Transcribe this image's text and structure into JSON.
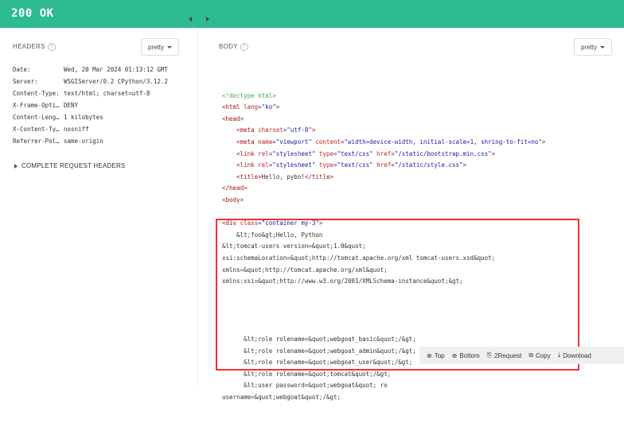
{
  "status": {
    "text": "200 OK",
    "color": "#2dbb8f"
  },
  "headers_panel": {
    "title": "HEADERS",
    "format": "pretty",
    "rows": [
      {
        "key": "Date:",
        "value": "Wed, 20 Mar 2024 01:13:12 GMT"
      },
      {
        "key": "Server:",
        "value": "WSGIServer/0.2 CPython/3.12.2"
      },
      {
        "key": "Content-Type:",
        "value": "text/html; charset=utf-8"
      },
      {
        "key": "X-Frame-Opti…",
        "value": "DENY"
      },
      {
        "key": "Content-Leng…",
        "value": "1 kilobytes"
      },
      {
        "key": "X-Content-Ty…",
        "value": "nosniff"
      },
      {
        "key": "Referrer-Pol…",
        "value": "same-origin"
      }
    ],
    "complete_request_label": "COMPLETE REQUEST HEADERS"
  },
  "body_panel": {
    "title": "BODY",
    "format": "pretty",
    "code": {
      "l01": "<!doctype html>",
      "l02a": "<html ",
      "l02b": "lang",
      "l02c": "=\"ko\"",
      "l02d": ">",
      "l03": "<head>",
      "l04a": "    <meta ",
      "l04b": "charset",
      "l04c": "=\"utf-8\"",
      "l04d": ">",
      "l05a": "    <meta ",
      "l05b": "name",
      "l05c": "=\"viewport\" ",
      "l05d": "content",
      "l05e": "=\"width=device-width, initial-scale=1, shring-to-fit=no\"",
      "l05f": ">",
      "l06a": "    <link ",
      "l06b": "rel",
      "l06c": "=\"stylesheet\" ",
      "l06d": "type",
      "l06e": "=\"text/css\" ",
      "l06f": "href",
      "l06g": "=\"/static/bootstrap.min.css\"",
      "l06h": ">",
      "l07a": "    <link ",
      "l07b": "rel",
      "l07c": "=\"stylesheet\" ",
      "l07d": "type",
      "l07e": "=\"text/css\" ",
      "l07f": "href",
      "l07g": "=\"/static/style.css\"",
      "l07h": ">",
      "l08a": "    <title>",
      "l08b": "Hello, pybo!",
      "l08c": "</title>",
      "l09": "</head>",
      "l10": "<body>",
      "l11a": "<div ",
      "l11b": "class",
      "l11c": "=\"container my-3\"",
      "l11d": ">",
      "l12": "    &lt;foo&gt;Hello, Python",
      "l13": "&lt;tomcat-users version=&quot;1.0&quot;",
      "l14": "xsi:schemaLocation=&quot;http://tomcat.apache.org/xml tomcat-users.xsd&quot;",
      "l15": "xmlns=&quot;http://tomcat.apache.org/xml&quot;",
      "l16": "xmlns:xsi=&quot;http://www.w3.org/2001/XMLSchema-instance&quot;&gt;",
      "l17": "      &lt;role rolename=&quot;webgoat_basic&quot;/&gt;",
      "l18": "      &lt;role rolename=&quot;webgoat_admin&quot;/&gt;",
      "l19": "      &lt;role rolename=&quot;webgoat_user&quot;/&gt;",
      "l20": "      &lt;role rolename=&quot;tomcat&quot;/&gt;",
      "l21": "      &lt;user password=&quot;webgoat&quot; ro",
      "l22": "username=&quot;webgoat&quot;/&gt;"
    }
  },
  "toolbar": {
    "top_label": "Top",
    "bottom_label": "Bottom",
    "request_label": "2Request",
    "copy_label": "Copy",
    "download_label": "Download"
  }
}
